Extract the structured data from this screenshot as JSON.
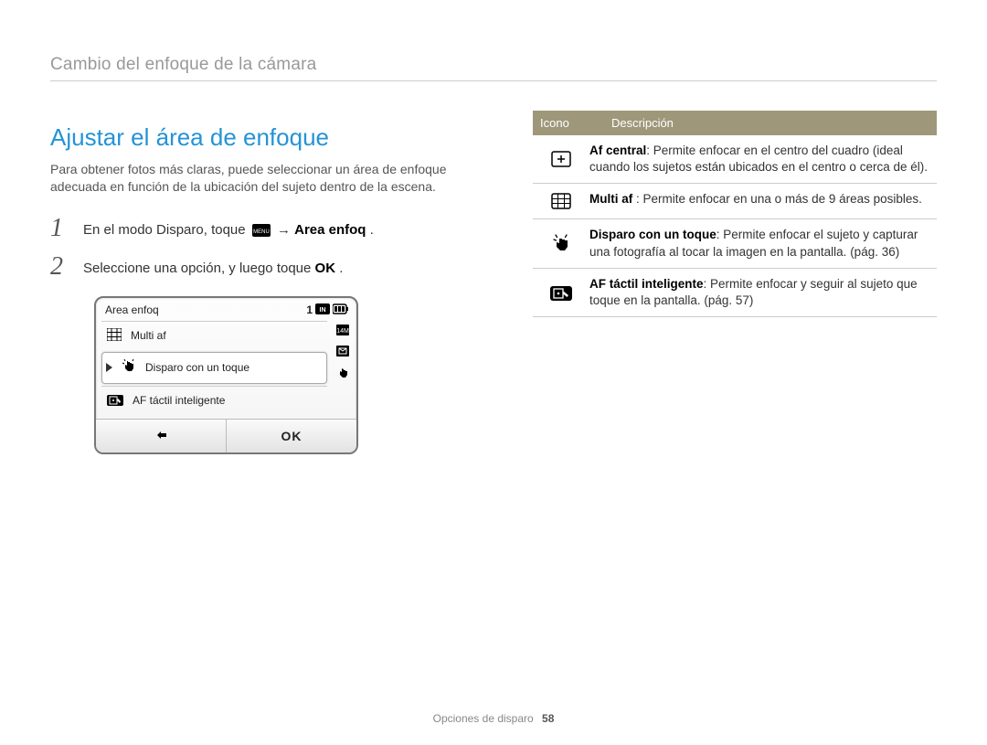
{
  "breadcrumb": "Cambio del enfoque de la cámara",
  "title": "Ajustar el área de enfoque",
  "intro": "Para obtener fotos más claras, puede seleccionar un área de enfoque adecuada en función de la ubicación del sujeto dentro de la escena.",
  "steps": {
    "s1": {
      "num": "1",
      "pre": "En el modo Disparo, toque ",
      "menu_label": "MENU",
      "arrow": " → ",
      "bold": "Area enfoq",
      "post": "."
    },
    "s2": {
      "num": "2",
      "pre": "Seleccione una opción, y luego toque ",
      "ok": "OK",
      "post": " ."
    }
  },
  "camera_ui": {
    "title": "Area enfoq",
    "status_count": "1",
    "items": {
      "i1": "Multi af",
      "i2": "Disparo con un toque",
      "i3": "AF táctil inteligente"
    },
    "btn_back": "↰",
    "btn_ok": "OK"
  },
  "table": {
    "head_icon": "Icono",
    "head_desc": "Descripción",
    "rows": {
      "r1": {
        "title": "Af central",
        "text": ": Permite enfocar en el centro del cuadro (ideal cuando los sujetos están ubicados en el centro o cerca de él)."
      },
      "r2": {
        "title": "Multi af",
        "text": " : Permite enfocar en una o más de 9 áreas posibles."
      },
      "r3": {
        "title": "Disparo con un toque",
        "text": ": Permite enfocar el sujeto y capturar una fotografía al tocar la imagen en la pantalla. (pág. 36)"
      },
      "r4": {
        "title": "AF táctil inteligente",
        "text": ": Permite enfocar y seguir al sujeto que toque en la pantalla. (pág. 57)"
      }
    }
  },
  "footer": {
    "section": "Opciones de disparo",
    "page": "58"
  }
}
